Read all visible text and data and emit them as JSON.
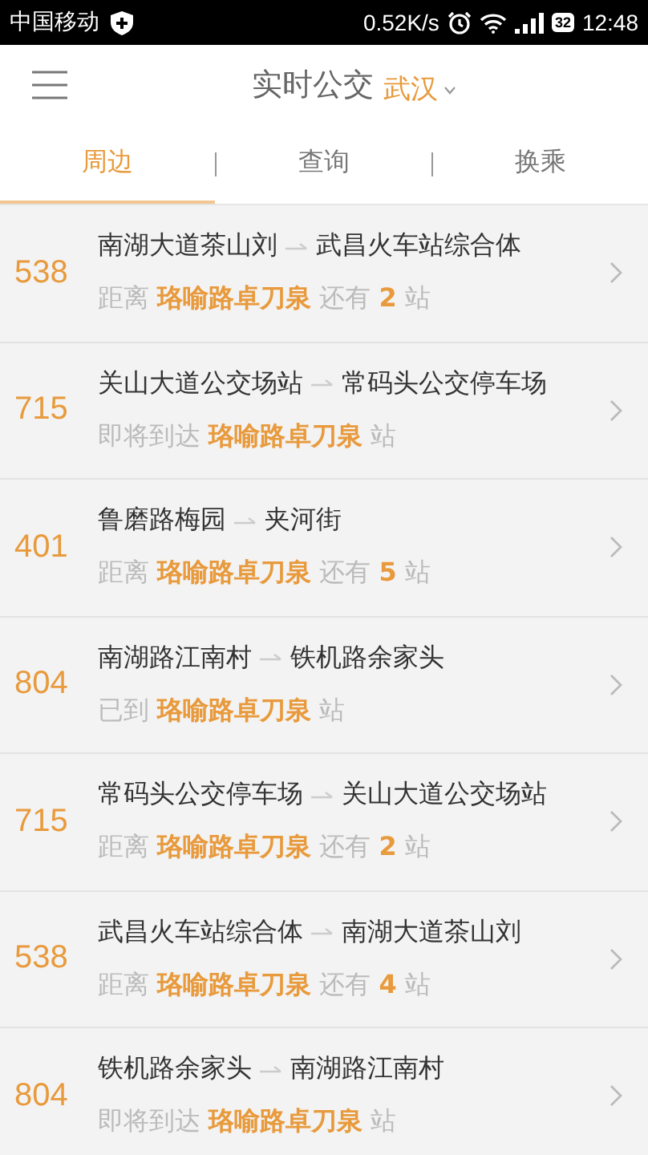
{
  "status_bar": {
    "carrier": "中国移动",
    "speed": "0.52K/s",
    "battery": "32",
    "time": "12:48"
  },
  "header": {
    "title": "实时公交",
    "city": "武汉"
  },
  "tabs": [
    {
      "label": "周边",
      "selected": true
    },
    {
      "label": "查询",
      "selected": false
    },
    {
      "label": "换乘",
      "selected": false
    }
  ],
  "routes": [
    {
      "number": "538",
      "from": "南湖大道茶山刘",
      "to": "武昌火车站综合体",
      "status": "距离 **珞喻路卓刀泉** 还有 **2** 站"
    },
    {
      "number": "715",
      "from": "关山大道公交场站",
      "to": "常码头公交停车场",
      "status": "即将到达 **珞喻路卓刀泉** 站"
    },
    {
      "number": "401",
      "from": "鲁磨路梅园",
      "to": "夹河街",
      "status": "距离 **珞喻路卓刀泉** 还有 **5** 站"
    },
    {
      "number": "804",
      "from": "南湖路江南村",
      "to": "铁机路余家头",
      "status": "已到 **珞喻路卓刀泉** 站"
    },
    {
      "number": "715",
      "from": "常码头公交停车场",
      "to": "关山大道公交场站",
      "status": "距离 **珞喻路卓刀泉** 还有 **2** 站"
    },
    {
      "number": "538",
      "from": "武昌火车站综合体",
      "to": "南湖大道茶山刘",
      "status": "距离 **珞喻路卓刀泉** 还有 **4** 站"
    },
    {
      "number": "804",
      "from": "铁机路余家头",
      "to": "南湖路江南村",
      "status": "即将到达 **珞喻路卓刀泉** 站"
    }
  ]
}
